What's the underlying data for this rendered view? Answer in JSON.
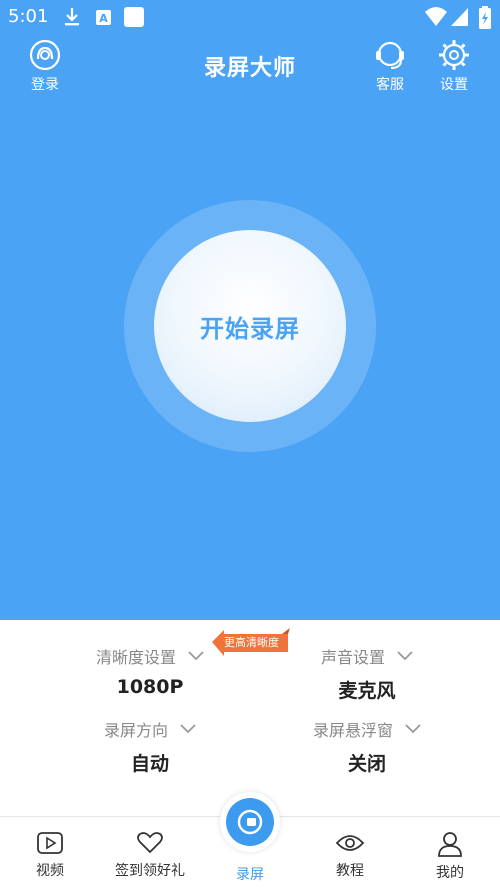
{
  "status_bar": {
    "time": "5:01"
  },
  "header": {
    "title": "录屏大师",
    "login_label": "登录",
    "service_label": "客服",
    "settings_label": "设置"
  },
  "main": {
    "start_button_label": "开始录屏"
  },
  "settings": {
    "badge": "更高清晰度",
    "items": [
      {
        "label": "清晰度设置",
        "value": "1080P"
      },
      {
        "label": "声音设置",
        "value": "麦克风"
      },
      {
        "label": "录屏方向",
        "value": "自动"
      },
      {
        "label": "录屏悬浮窗",
        "value": "关闭"
      }
    ]
  },
  "bottom_nav": {
    "items": [
      {
        "label": "视频",
        "icon": "play-icon"
      },
      {
        "label": "签到领好礼",
        "icon": "heart-icon"
      },
      {
        "label": "录屏",
        "icon": "record-icon",
        "active": true
      },
      {
        "label": "教程",
        "icon": "eye-icon"
      },
      {
        "label": "我的",
        "icon": "user-icon"
      }
    ]
  },
  "colors": {
    "primary": "#4aa3f5",
    "active_nav": "#3d9bef",
    "badge": "#f0743a"
  }
}
